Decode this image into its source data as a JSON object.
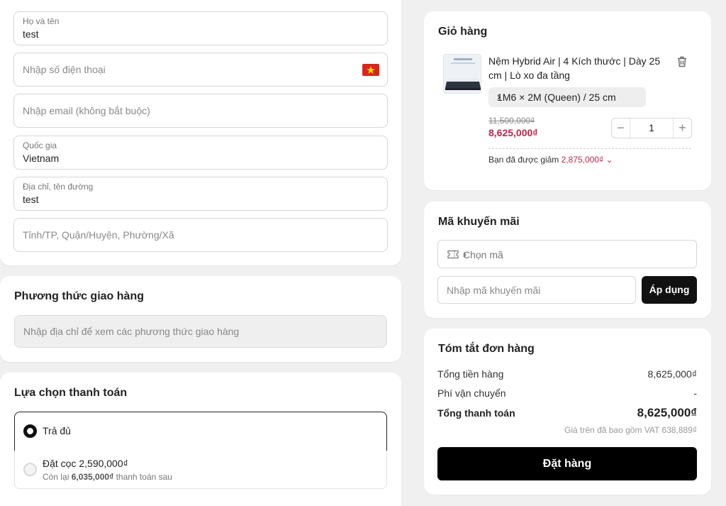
{
  "form": {
    "name": {
      "label": "Họ và tên",
      "value": "test"
    },
    "phone": {
      "placeholder": "Nhập số điện thoại"
    },
    "email": {
      "placeholder": "Nhập email (không bắt buộc)"
    },
    "country": {
      "label": "Quốc gia",
      "value": "Vietnam"
    },
    "address": {
      "label": "Địa chỉ, tên đường",
      "value": "test"
    },
    "region": {
      "placeholder": "Tỉnh/TP, Quận/Huyện, Phường/Xã"
    }
  },
  "shipping": {
    "title": "Phương thức giao hàng",
    "placeholder": "Nhập địa chỉ để xem các phương thức giao hàng"
  },
  "payment": {
    "title": "Lựa chọn thanh toán",
    "options": [
      {
        "label": "Trả đủ",
        "selected": true
      },
      {
        "label": "Đặt cọc 2,590,000₫",
        "sub_prefix": "Còn lại ",
        "sub_amount": "6,035,000₫",
        "sub_suffix": " thanh toán sau",
        "selected": false
      }
    ]
  },
  "cart": {
    "title": "Giỏ hàng",
    "item": {
      "name": "Nệm Hybrid Air | 4 Kích thước | Dày 25 cm | Lò xo đa tầng",
      "variant": "1M6 × 2M (Queen) / 25 cm",
      "old_price": "11,500,000₫",
      "price": "8,625,000₫",
      "quantity": "1",
      "discount_label": "Bạn đã được giảm ",
      "discount_amount": "2,875,000₫"
    }
  },
  "promo": {
    "title": "Mã khuyến mãi",
    "select_placeholder": "Chọn mã",
    "input_placeholder": "Nhập mã khuyến mãi",
    "apply_label": "Áp dụng"
  },
  "summary": {
    "title": "Tóm tắt đơn hàng",
    "subtotal_label": "Tổng tiền hàng",
    "subtotal": "8,625,000₫",
    "shipping_label": "Phí vận chuyển",
    "shipping": "-",
    "total_label": "Tổng thanh toán",
    "total": "8,625,000₫",
    "vat_note": "Giá trên đã bao gồm VAT 638,889₫",
    "order_label": "Đặt hàng"
  },
  "colors": {
    "accent_price": "#c0244a",
    "button": "#000000",
    "flag_red": "#da251d",
    "flag_star": "#ffde00"
  }
}
